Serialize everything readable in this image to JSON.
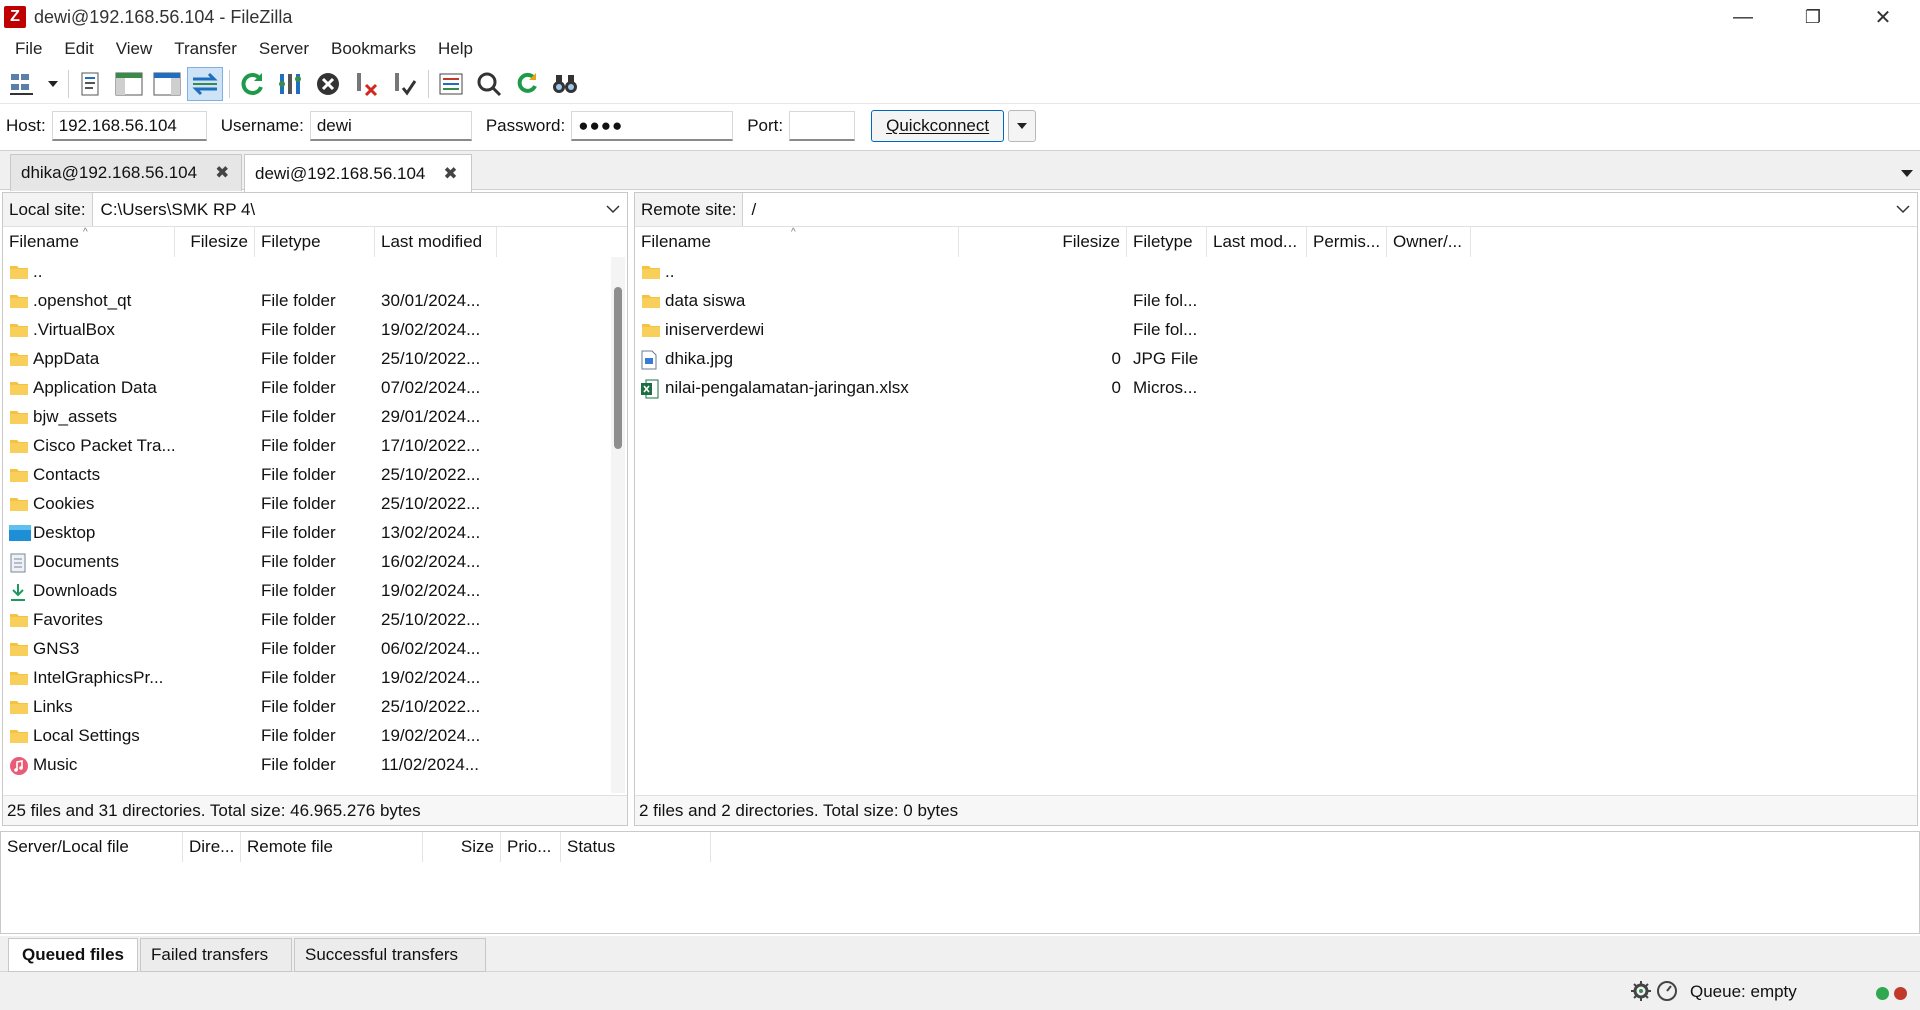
{
  "window": {
    "title": "dewi@192.168.56.104 - FileZilla",
    "app_icon_letter": "Z",
    "minimize": "—",
    "maximize": "❐",
    "close": "✕"
  },
  "menu": [
    "File",
    "Edit",
    "View",
    "Transfer",
    "Server",
    "Bookmarks",
    "Help"
  ],
  "toolbar": {
    "icons": [
      "site-manager-icon",
      "dropdown-icon",
      "message-log-icon",
      "local-tree-icon",
      "remote-tree-icon",
      "transfer-queue-icon",
      "refresh-icon",
      "process-queue-icon",
      "cancel-icon",
      "disconnect-icon",
      "reconnect-icon",
      "filter-icon",
      "search-icon",
      "sync-browse-icon",
      "find-files-icon"
    ]
  },
  "quickconnect": {
    "host_label": "Host:",
    "host_value": "192.168.56.104",
    "username_label": "Username:",
    "username_value": "dewi",
    "password_label": "Password:",
    "password_value": "●●●●",
    "port_label": "Port:",
    "port_value": "",
    "button_label": "Quickconnect"
  },
  "tabs": [
    {
      "label": "dhika@192.168.56.104",
      "close": "✖",
      "active": false
    },
    {
      "label": "dewi@192.168.56.104",
      "close": "✖",
      "active": true
    }
  ],
  "local": {
    "site_label": "Local site:",
    "path": "C:\\Users\\SMK RP 4\\",
    "columns": [
      "Filename",
      "Filesize",
      "Filetype",
      "Last modified"
    ],
    "rows": [
      {
        "name": "..",
        "icon": "folder",
        "type": "",
        "modified": ""
      },
      {
        "name": ".openshot_qt",
        "icon": "folder",
        "type": "File folder",
        "modified": "30/01/2024..."
      },
      {
        "name": ".VirtualBox",
        "icon": "folder",
        "type": "File folder",
        "modified": "19/02/2024..."
      },
      {
        "name": "AppData",
        "icon": "folder",
        "type": "File folder",
        "modified": "25/10/2022..."
      },
      {
        "name": "Application Data",
        "icon": "folder",
        "type": "File folder",
        "modified": "07/02/2024..."
      },
      {
        "name": "bjw_assets",
        "icon": "folder",
        "type": "File folder",
        "modified": "29/01/2024..."
      },
      {
        "name": "Cisco Packet Tra...",
        "icon": "folder",
        "type": "File folder",
        "modified": "17/10/2022..."
      },
      {
        "name": "Contacts",
        "icon": "folder",
        "type": "File folder",
        "modified": "25/10/2022..."
      },
      {
        "name": "Cookies",
        "icon": "folder",
        "type": "File folder",
        "modified": "25/10/2022..."
      },
      {
        "name": "Desktop",
        "icon": "desktop",
        "type": "File folder",
        "modified": "13/02/2024..."
      },
      {
        "name": "Documents",
        "icon": "documents",
        "type": "File folder",
        "modified": "16/02/2024..."
      },
      {
        "name": "Downloads",
        "icon": "downloads",
        "type": "File folder",
        "modified": "19/02/2024..."
      },
      {
        "name": "Favorites",
        "icon": "folder",
        "type": "File folder",
        "modified": "25/10/2022..."
      },
      {
        "name": "GNS3",
        "icon": "folder",
        "type": "File folder",
        "modified": "06/02/2024..."
      },
      {
        "name": "IntelGraphicsPr...",
        "icon": "folder",
        "type": "File folder",
        "modified": "19/02/2024..."
      },
      {
        "name": "Links",
        "icon": "folder",
        "type": "File folder",
        "modified": "25/10/2022..."
      },
      {
        "name": "Local Settings",
        "icon": "folder",
        "type": "File folder",
        "modified": "19/02/2024..."
      },
      {
        "name": "Music",
        "icon": "music",
        "type": "File folder",
        "modified": "11/02/2024..."
      }
    ],
    "status": "25 files and 31 directories. Total size: 46.965.276 bytes"
  },
  "remote": {
    "site_label": "Remote site:",
    "path": "/",
    "columns": [
      "Filename",
      "Filesize",
      "Filetype",
      "Last mod...",
      "Permis...",
      "Owner/..."
    ],
    "rows": [
      {
        "name": "..",
        "icon": "folder",
        "size": "",
        "type": ""
      },
      {
        "name": "data siswa",
        "icon": "folder",
        "size": "",
        "type": "File fol..."
      },
      {
        "name": "iniserverdewi",
        "icon": "folder",
        "size": "",
        "type": "File fol..."
      },
      {
        "name": "dhika.jpg",
        "icon": "image",
        "size": "0",
        "type": "JPG File"
      },
      {
        "name": "nilai-pengalamatan-jaringan.xlsx",
        "icon": "excel",
        "size": "0",
        "type": "Micros..."
      }
    ],
    "status": "2 files and 2 directories. Total size: 0 bytes"
  },
  "queue": {
    "columns": [
      "Server/Local file",
      "Dire...",
      "Remote file",
      "Size",
      "Prio...",
      "Status"
    ],
    "tabs": [
      "Queued files",
      "Failed transfers",
      "Successful transfers"
    ]
  },
  "statusbar": {
    "queue_text": "Queue: empty",
    "led_colors": [
      "#2fa84f",
      "#c0392b"
    ]
  }
}
